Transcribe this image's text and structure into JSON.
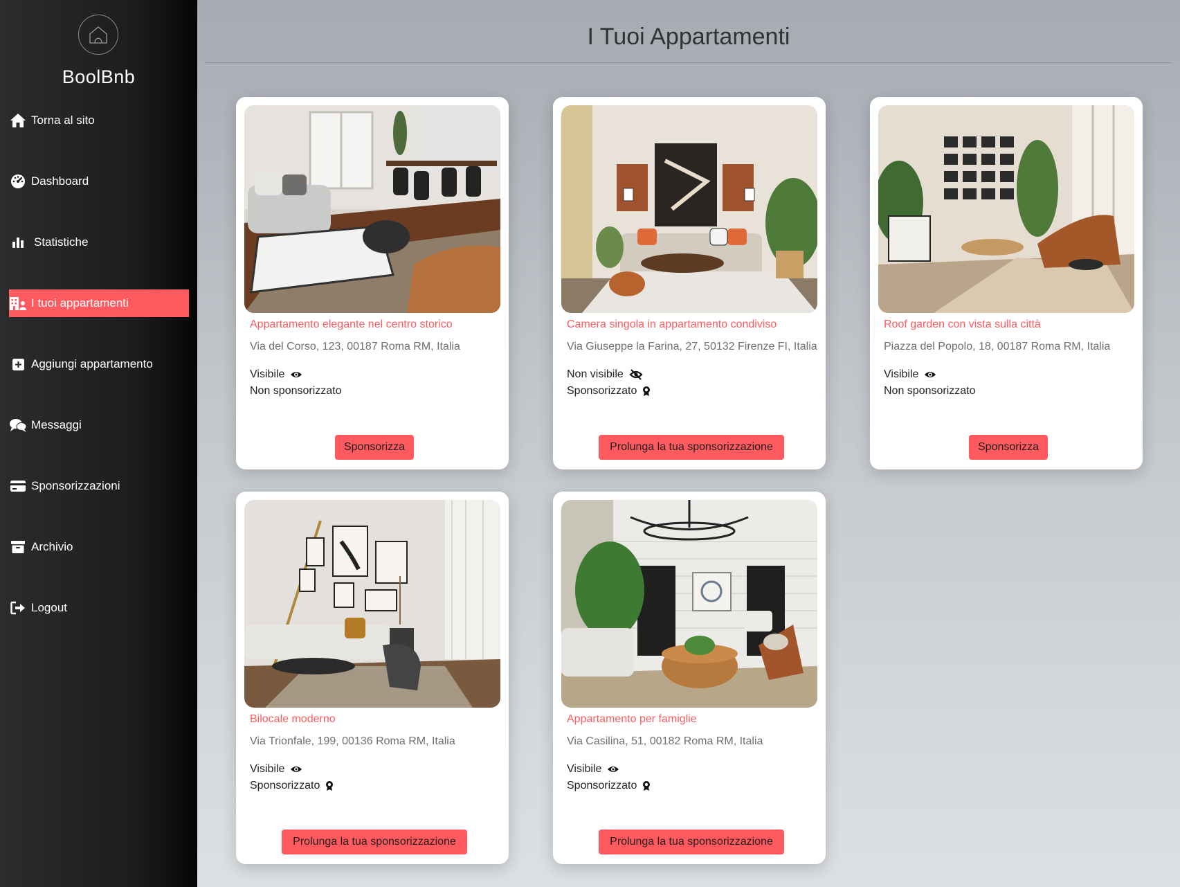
{
  "sidebar": {
    "brand": "BoolBnb",
    "items": [
      {
        "label": "Torna al sito",
        "icon": "home-icon"
      },
      {
        "label": "Dashboard",
        "icon": "gauge-icon"
      },
      {
        "label": "Statistiche",
        "icon": "bar-chart-icon"
      },
      {
        "label": "I tuoi appartamenti",
        "icon": "building-icon",
        "active": true
      },
      {
        "label": "Aggiungi appartamento",
        "icon": "plus-square-icon"
      },
      {
        "label": "Messaggi",
        "icon": "comments-icon"
      },
      {
        "label": "Sponsorizzazioni",
        "icon": "credit-card-icon"
      },
      {
        "label": "Archivio",
        "icon": "archive-icon"
      },
      {
        "label": "Logout",
        "icon": "logout-icon"
      }
    ]
  },
  "main": {
    "title": "I Tuoi Appartamenti",
    "apartments": [
      {
        "title": "Appartamento elegante nel centro storico",
        "address": "Via del Corso, 123, 00187 Roma RM, Italia",
        "visibility": "Visibile",
        "sponsorship": "Non sponsorizzato",
        "button": "Sponsorizza"
      },
      {
        "title": "Camera singola in appartamento condiviso",
        "address": "Via Giuseppe la Farina, 27, 50132 Firenze FI, Italia",
        "visibility": "Non visibile",
        "sponsorship": "Sponsorizzato",
        "button": "Prolunga la tua sponsorizzazione"
      },
      {
        "title": "Roof garden con vista sulla città",
        "address": "Piazza del Popolo, 18, 00187 Roma RM, Italia",
        "visibility": "Visibile",
        "sponsorship": "Non sponsorizzato",
        "button": "Sponsorizza"
      },
      {
        "title": "Bilocale moderno",
        "address": "Via Trionfale, 199, 00136 Roma RM, Italia",
        "visibility": "Visibile",
        "sponsorship": "Sponsorizzato",
        "button": "Prolunga la tua sponsorizzazione"
      },
      {
        "title": "Appartamento per famiglie",
        "address": "Via Casilina, 51, 00182 Roma RM, Italia",
        "visibility": "Visibile",
        "sponsorship": "Sponsorizzato",
        "button": "Prolunga la tua sponsorizzazione"
      }
    ]
  },
  "colors": {
    "accent": "#ff5a5f",
    "sidebar_bg": "#1c1c1c",
    "card_bg": "#ffffff"
  }
}
